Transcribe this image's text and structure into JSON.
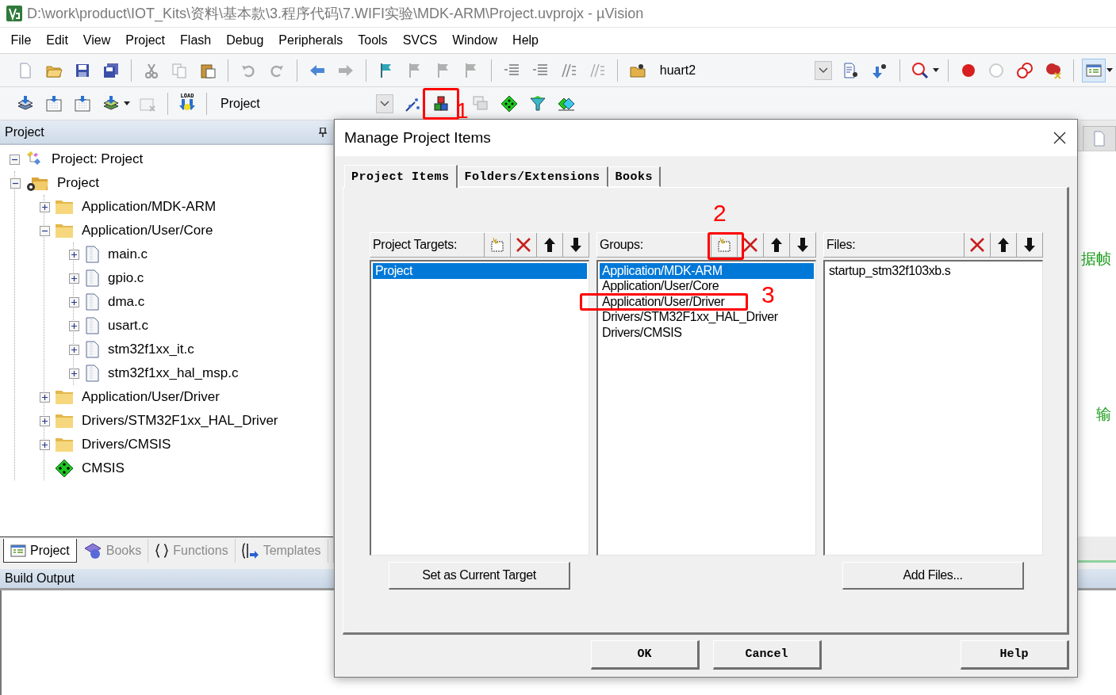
{
  "window": {
    "title": "D:\\work\\product\\IOT_Kits\\资料\\基本款\\3.程序代码\\7.WIFI实验\\MDK-ARM\\Project.uvprojx - µVision"
  },
  "menu": [
    "File",
    "Edit",
    "View",
    "Project",
    "Flash",
    "Debug",
    "Peripherals",
    "Tools",
    "SVCS",
    "Window",
    "Help"
  ],
  "toolbar_1": {
    "find_combo": {
      "value": "huart2"
    }
  },
  "toolbar_2": {
    "load_label": "LOAD",
    "target_combo": {
      "value": "Project"
    },
    "manage_button": {
      "highlighted": true,
      "annotation": "1"
    }
  },
  "project_pane": {
    "title": "Project",
    "tree": [
      {
        "label": "Project: Project",
        "kind": "project",
        "expanded": true,
        "children": [
          {
            "label": "Project",
            "kind": "target",
            "expanded": true,
            "children": [
              {
                "label": "Application/MDK-ARM",
                "kind": "group",
                "expanded": false
              },
              {
                "label": "Application/User/Core",
                "kind": "group",
                "expanded": true,
                "children": [
                  {
                    "label": "main.c",
                    "kind": "file",
                    "expanded": false
                  },
                  {
                    "label": "gpio.c",
                    "kind": "file",
                    "expanded": false
                  },
                  {
                    "label": "dma.c",
                    "kind": "file",
                    "expanded": false
                  },
                  {
                    "label": "usart.c",
                    "kind": "file",
                    "expanded": false
                  },
                  {
                    "label": "stm32f1xx_it.c",
                    "kind": "file",
                    "expanded": false
                  },
                  {
                    "label": "stm32f1xx_hal_msp.c",
                    "kind": "file",
                    "expanded": false
                  }
                ]
              },
              {
                "label": "Application/User/Driver",
                "kind": "group",
                "expanded": false
              },
              {
                "label": "Drivers/STM32F1xx_HAL_Driver",
                "kind": "group",
                "expanded": false
              },
              {
                "label": "Drivers/CMSIS",
                "kind": "group",
                "expanded": false
              },
              {
                "label": "CMSIS",
                "kind": "component"
              }
            ]
          }
        ]
      }
    ],
    "tabs": [
      {
        "label": "Project",
        "kind": "project",
        "selected": true
      },
      {
        "label": "Books",
        "kind": "books",
        "selected": false
      },
      {
        "label": "Functions",
        "kind": "functions",
        "selected": false
      },
      {
        "label": "Templates",
        "kind": "templates",
        "selected": false
      }
    ]
  },
  "editor": {
    "lines": [
      "据帧",
      "输"
    ]
  },
  "build_output": {
    "title": "Build Output"
  },
  "dialog": {
    "title": "Manage Project Items",
    "tabs": [
      {
        "label": "Project Items",
        "selected": true
      },
      {
        "label": "Folders/Extensions",
        "selected": false
      },
      {
        "label": "Books",
        "selected": false
      }
    ],
    "panes": [
      {
        "label": "Project Targets:",
        "tools": [
          {
            "kind": "new",
            "highlighted": false
          },
          {
            "kind": "delete",
            "highlighted": false
          },
          {
            "kind": "up",
            "highlighted": false
          },
          {
            "kind": "down",
            "highlighted": false
          }
        ],
        "items": [
          {
            "label": "Project",
            "selected": true,
            "highlighted": false
          }
        ],
        "action": "Set as Current Target"
      },
      {
        "label": "Groups:",
        "tools": [
          {
            "kind": "new",
            "highlighted": true,
            "annotation": "2"
          },
          {
            "kind": "delete",
            "highlighted": false
          },
          {
            "kind": "up",
            "highlighted": false
          },
          {
            "kind": "down",
            "highlighted": false
          }
        ],
        "items": [
          {
            "label": "Application/MDK-ARM",
            "selected": true,
            "highlighted": false
          },
          {
            "label": "Application/User/Core",
            "selected": false,
            "highlighted": false
          },
          {
            "label": "Application/User/Driver",
            "selected": false,
            "highlighted": true,
            "annotation": "3"
          },
          {
            "label": "Drivers/STM32F1xx_HAL_Driver",
            "selected": false,
            "highlighted": false
          },
          {
            "label": "Drivers/CMSIS",
            "selected": false,
            "highlighted": false
          }
        ]
      },
      {
        "label": "Files:",
        "tools": [
          {
            "kind": "delete",
            "highlighted": false
          },
          {
            "kind": "up",
            "highlighted": false
          },
          {
            "kind": "down",
            "highlighted": false
          }
        ],
        "items": [
          {
            "label": "startup_stm32f103xb.s",
            "selected": false,
            "highlighted": false
          }
        ],
        "action": "Add Files..."
      }
    ],
    "buttons": [
      "OK",
      "Cancel",
      "Help"
    ]
  }
}
